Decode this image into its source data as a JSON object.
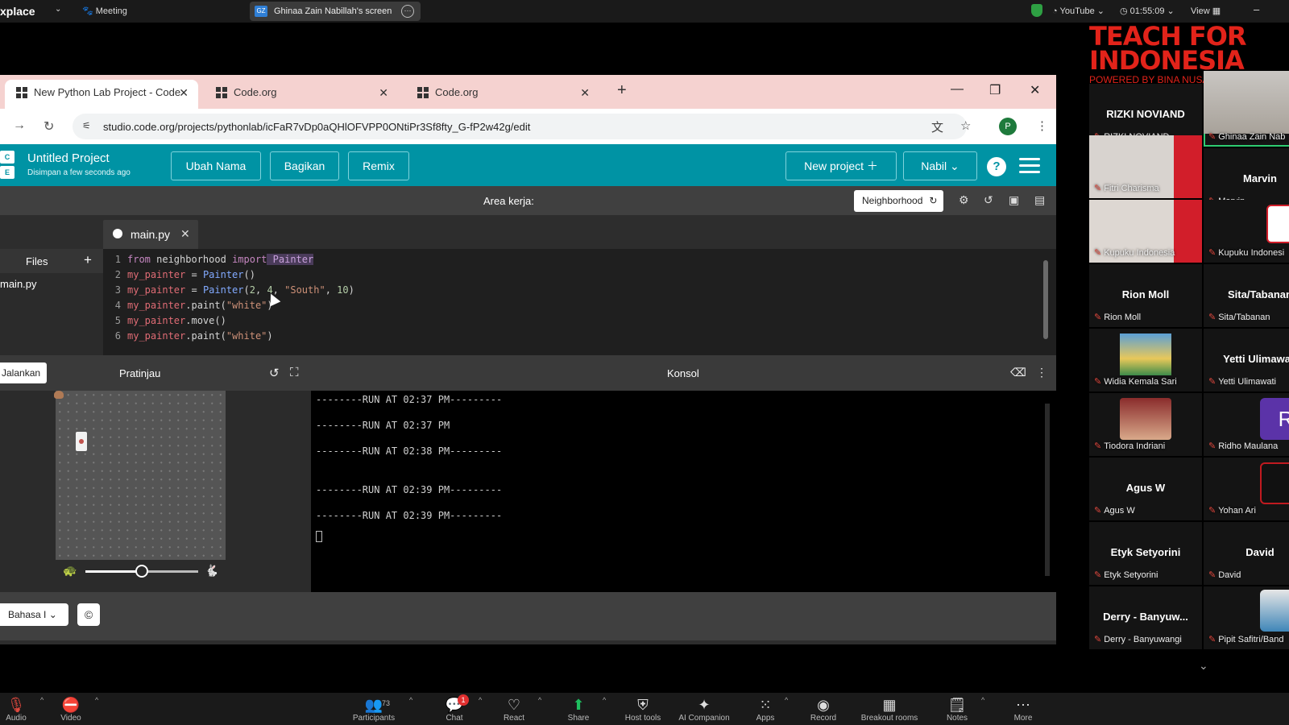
{
  "zoom_top": {
    "workspace_title": "xplace",
    "meeting_label": "Meeting",
    "share_initials": "GZ",
    "share_label": "Ghinaa Zain Nabillah's screen",
    "youtube_label": "YouTube",
    "clock": "01:55:09",
    "view_label": "View"
  },
  "browser": {
    "tabs": [
      {
        "title": "New Python Lab Project - Code"
      },
      {
        "title": "Code.org"
      },
      {
        "title": "Code.org"
      }
    ],
    "url": "studio.code.org/projects/pythonlab/icFaR7vDp0aQHlOFVPP0ONtiPr3Sf8fty_G-fP2w42g/edit",
    "profile_initial": "P"
  },
  "app": {
    "project_title": "Untitled Project",
    "saved_status": "Disimpan a few seconds ago",
    "rename_button": "Ubah Nama",
    "share_button": "Bagikan",
    "remix_button": "Remix",
    "new_project_button": "New project",
    "user_menu": "Nabil",
    "help_icon": "?",
    "workspace_label": "Area kerja:",
    "neighborhood_button": "Neighborhood"
  },
  "editor": {
    "file_tab": "main.py",
    "files_label": "Files",
    "file_item": "main.py",
    "line_numbers": [
      "1",
      "2",
      "3",
      "4",
      "5",
      "6"
    ]
  },
  "preview": {
    "run_button": "Jalankan",
    "label": "Pratinjau",
    "speed_level": 0.5
  },
  "console": {
    "label": "Konsol",
    "lines": [
      "--------RUN AT 02:37 PM---------",
      "--------RUN AT 02:37 PM",
      "--------RUN AT 02:38 PM---------",
      "--------RUN AT 02:39 PM---------",
      "--------RUN AT 02:39 PM---------"
    ]
  },
  "footer": {
    "language_select": "Bahasa I",
    "cc_icon": "©"
  },
  "gallery": {
    "brand_line1": "TEACH FOR",
    "brand_line2": "INDONESIA",
    "brand_line3": "POWERED BY BINA NUSANTARA",
    "tiles": [
      {
        "name": "RIZKI NOVIAND",
        "label": "RIZKI NOVIAND"
      },
      {
        "name": "",
        "label": "Ghinaa Zain Nab"
      },
      {
        "name": "",
        "label": "Fitri Charisma"
      },
      {
        "name": "Marvin",
        "label": "Marvin"
      },
      {
        "name": "",
        "label": "Kupuku Indonesia"
      },
      {
        "name": "",
        "label": "Kupuku Indonesi"
      },
      {
        "name": "Rion Moll",
        "label": "Rion Moll"
      },
      {
        "name": "Sita/Tabanan",
        "label": "Sita/Tabanan"
      },
      {
        "name": "",
        "label": "Widia Kemala Sari"
      },
      {
        "name": "Yetti Ulimawati",
        "label": "Yetti Ulimawati"
      },
      {
        "name": "",
        "label": "Tiodora Indriani"
      },
      {
        "name": "R",
        "label": "Ridho Maulana"
      },
      {
        "name": "Agus W",
        "label": "Agus W"
      },
      {
        "name": "",
        "label": "Yohan Ari"
      },
      {
        "name": "Etyk Setyorini",
        "label": "Etyk Setyorini"
      },
      {
        "name": "David",
        "label": "David"
      },
      {
        "name": "Derry - Banyuw...",
        "label": "Derry - Banyuwangi"
      },
      {
        "name": "",
        "label": "Pipit Safitri/Band"
      }
    ]
  },
  "zoom_bar": {
    "audio": "Audio",
    "video": "Video",
    "participants": "Participants",
    "participants_count": "73",
    "chat": "Chat",
    "chat_badge": "1",
    "react": "React",
    "share": "Share",
    "host_tools": "Host tools",
    "ai_companion": "AI Companion",
    "apps": "Apps",
    "record": "Record",
    "breakout_rooms": "Breakout rooms",
    "notes": "Notes",
    "more": "More"
  }
}
